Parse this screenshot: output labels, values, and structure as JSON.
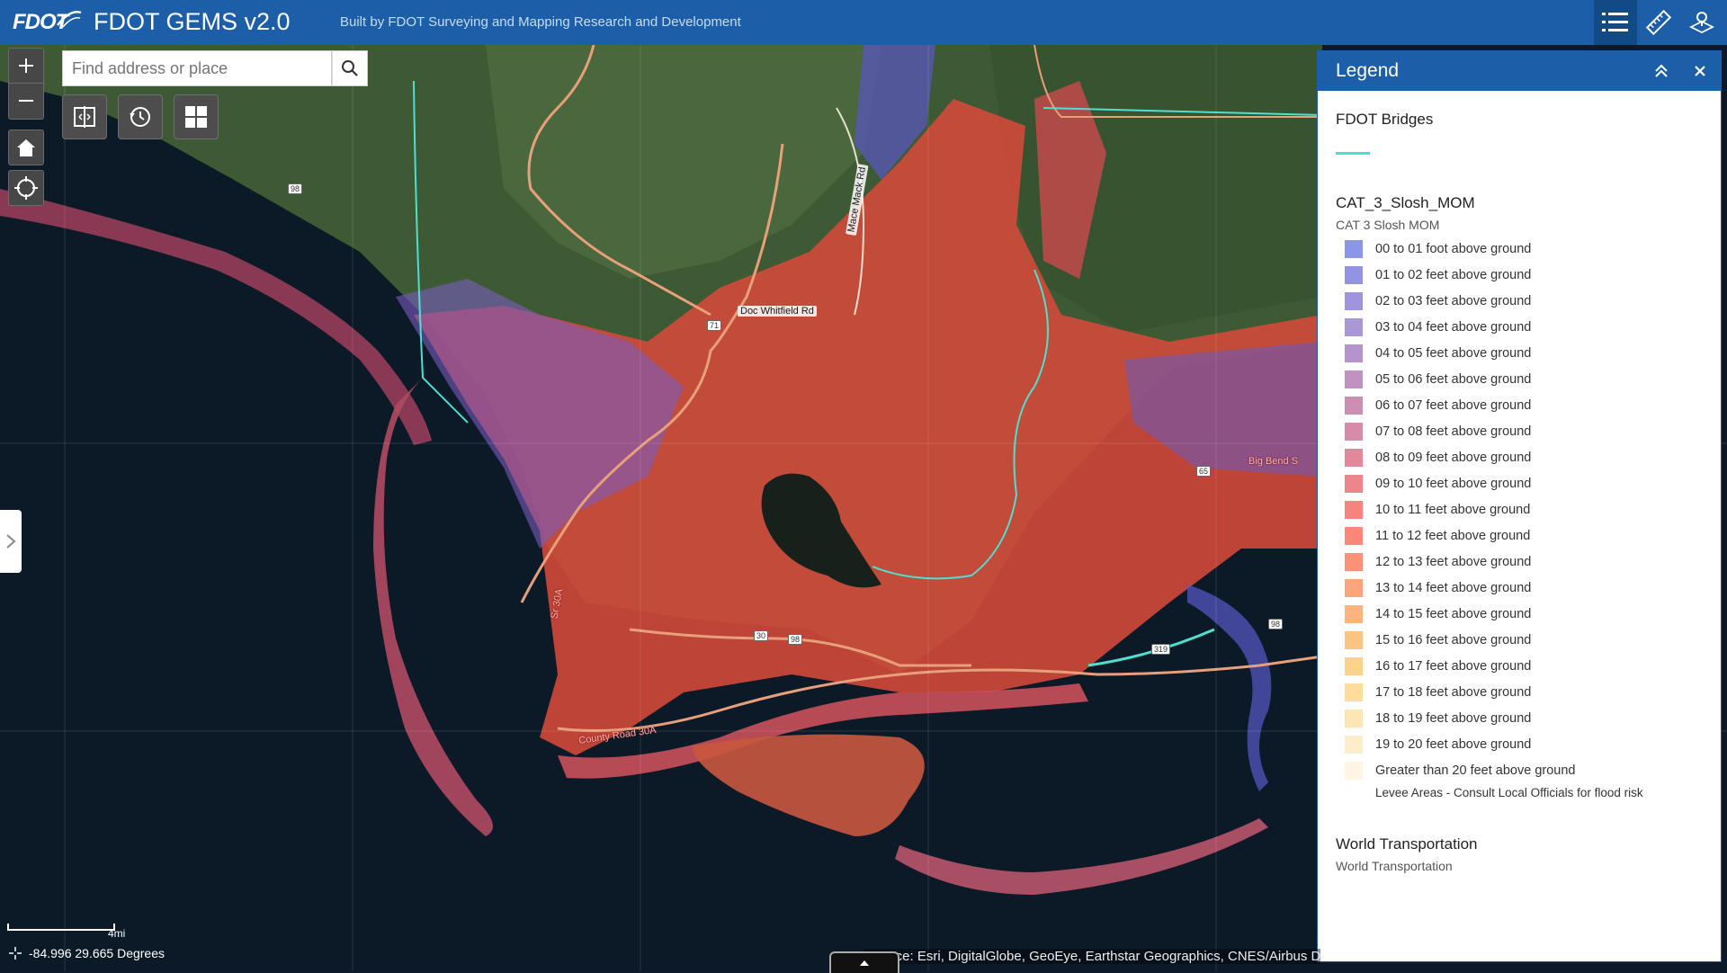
{
  "header": {
    "logo_text": "FDOT",
    "title": "FDOT GEMS v2.0",
    "subtitle": "Built by FDOT Surveying and Mapping Research and Development",
    "buttons": [
      {
        "name": "legend",
        "icon": "list-icon",
        "active": true
      },
      {
        "name": "measure",
        "icon": "ruler-icon",
        "active": false
      },
      {
        "name": "identify",
        "icon": "location-layers-icon",
        "active": false
      }
    ]
  },
  "map": {
    "search": {
      "placeholder": "Find address or place",
      "value": ""
    },
    "labels": {
      "road1": "Doc Whitfield Rd",
      "road2": "Mace Mack Rd",
      "road3": "Big Bend S",
      "road4": "County Road 30A",
      "road5": "Sr 30A"
    },
    "shields": [
      "98",
      "71",
      "30",
      "98",
      "65",
      "319",
      "98"
    ],
    "scale_label": "4mi",
    "coordinates": "-84.996 29.665 Degrees",
    "attribution": "Source: Esri, DigitalGlobe, GeoEye, Earthstar Geographics, CNES/Airbus DS, USDA, USGS"
  },
  "legend": {
    "title": "Legend",
    "layers": [
      {
        "title": "FDOT Bridges",
        "line_color": "#4de0d0"
      },
      {
        "title": "CAT_3_Slosh_MOM",
        "subtitle": "CAT 3 Slosh MOM"
      },
      {
        "title": "World Transportation",
        "subtitle": "World Transportation"
      }
    ],
    "classes": [
      {
        "label": "00 to 01 foot above ground",
        "color": "#8c96e8"
      },
      {
        "label": "01 to 02 feet above ground",
        "color": "#9393e2"
      },
      {
        "label": "02 to 03 feet above ground",
        "color": "#9e95de"
      },
      {
        "label": "03 to 04 feet above ground",
        "color": "#ab96d6"
      },
      {
        "label": "04 to 05 feet above ground",
        "color": "#b594cc"
      },
      {
        "label": "05 to 06 feet above ground",
        "color": "#bf92c2"
      },
      {
        "label": "06 to 07 feet above ground",
        "color": "#cb8fb4"
      },
      {
        "label": "07 to 08 feet above ground",
        "color": "#d68ca6"
      },
      {
        "label": "08 to 09 feet above ground",
        "color": "#e3889a"
      },
      {
        "label": "09 to 10 feet above ground",
        "color": "#ec858c"
      },
      {
        "label": "10 to 11 feet above ground",
        "color": "#f5847f"
      },
      {
        "label": "11 to 12 feet above ground",
        "color": "#fa8878"
      },
      {
        "label": "12 to 13 feet above ground",
        "color": "#fb9276"
      },
      {
        "label": "13 to 14 feet above ground",
        "color": "#fca47a"
      },
      {
        "label": "14 to 15 feet above ground",
        "color": "#fcb57e"
      },
      {
        "label": "15 to 16 feet above ground",
        "color": "#fcc482"
      },
      {
        "label": "16 to 17 feet above ground",
        "color": "#fdd28a"
      },
      {
        "label": "17 to 18 feet above ground",
        "color": "#fddc9c"
      },
      {
        "label": "18 to 19 feet above ground",
        "color": "#fde6b4"
      },
      {
        "label": "19 to 20 feet above ground",
        "color": "#fdeecb"
      },
      {
        "label": "Greater than 20 feet above ground",
        "color": "#fef5e4"
      },
      {
        "label": "Levee Areas - Consult Local Officials for flood risk",
        "color": "#ffffff"
      }
    ]
  }
}
